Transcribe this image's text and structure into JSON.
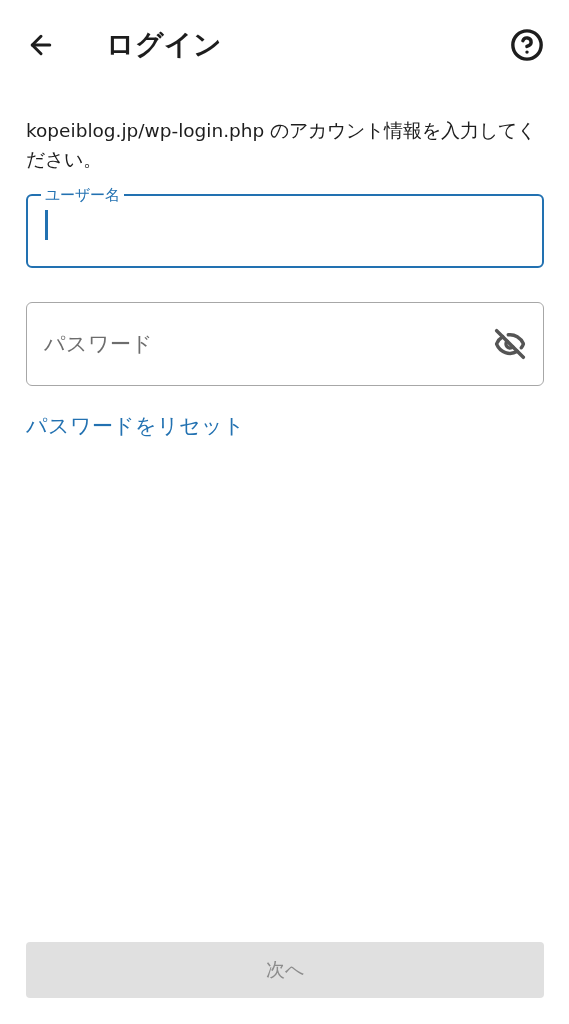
{
  "header": {
    "title": "ログイン"
  },
  "instructions": "kopeiblog.jp/wp-login.php のアカウント情報を入力してください。",
  "fields": [
    {
      "kind": "text",
      "label": "ユーザー名",
      "focused": true
    },
    {
      "kind": "password",
      "placeholder": "パスワード",
      "focused": false,
      "password_visible": false
    }
  ],
  "reset_link": "パスワードをリセット",
  "next_button": {
    "label": "次へ",
    "disabled": true
  }
}
